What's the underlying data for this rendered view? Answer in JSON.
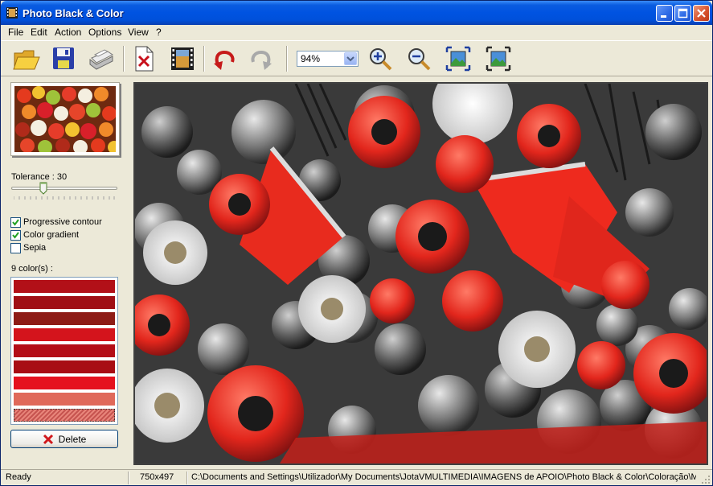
{
  "window": {
    "title": "Photo Black & Color"
  },
  "menu": [
    "File",
    "Edit",
    "Action",
    "Options",
    "View",
    "?"
  ],
  "toolbar": {
    "tools": [
      "open-folder-icon",
      "save-disk-icon",
      "print-icon",
      "new-document-icon",
      "film-icon",
      "undo-icon",
      "redo-icon",
      "zoom-in-icon",
      "zoom-out-icon",
      "fit-window-icon",
      "actual-size-icon"
    ],
    "zoom_value": "94%"
  },
  "panel": {
    "tolerance_label": "Tolerance : 30",
    "tolerance_value": 30,
    "options": [
      {
        "label": "Progressive contour",
        "checked": true
      },
      {
        "label": "Color gradient",
        "checked": true
      },
      {
        "label": "Sepia",
        "checked": false
      }
    ],
    "colors_label": "9 color(s) :",
    "swatches": [
      "#B21018",
      "#A00F15",
      "#8E1C16",
      "#D4141C",
      "#B40E17",
      "#A80D14",
      "#E5121F",
      "#E0695A",
      "hatched"
    ],
    "delete_label": "Delete"
  },
  "status": {
    "state": "Ready",
    "dimensions": "750x497",
    "path": "C:\\Documents and Settings\\Utilizador\\My Documents\\JotaVMULTIMEDIA\\IMAGENS de APOIO\\Photo Black & Color\\Coloração\\Mesa"
  }
}
